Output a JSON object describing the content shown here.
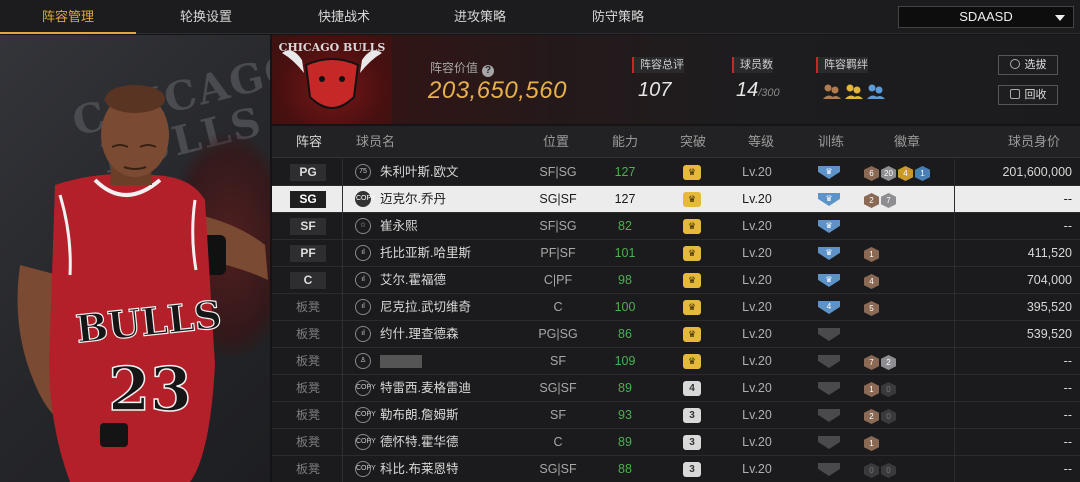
{
  "tabs": [
    "阵容管理",
    "轮换设置",
    "快捷战术",
    "进攻策略",
    "防守策略"
  ],
  "dropdown": {
    "selected": "SDAASD"
  },
  "left_panel": {
    "bg_text_1": "CHICAGO",
    "bg_text_2": "BULLS",
    "jersey_text": "BULLS",
    "jersey_number": "23"
  },
  "header": {
    "logo_text": "CHICAGO BULLS",
    "team_value_label": "阵容价值",
    "team_value": "203,650,560",
    "overall_label": "阵容总评",
    "overall_value": "107",
    "players_label": "球员数",
    "players_value": "14",
    "players_max": "/300",
    "bond_label": "阵容羁绊",
    "buttons": {
      "select": "选拔",
      "recycle": "回收"
    }
  },
  "table": {
    "headers": [
      "阵容",
      "球员名",
      "位置",
      "能力",
      "突破",
      "等级",
      "训练",
      "徽章",
      "球员身价"
    ],
    "rows": [
      {
        "slot": "PG",
        "icon": "75",
        "name": "朱利叶斯.欧文",
        "pos": "SF|SG",
        "ability": "127",
        "break": "crown",
        "level": "Lv.20",
        "train": "on",
        "badges": [
          [
            "b",
            "6"
          ],
          [
            "s",
            "20"
          ],
          [
            "g",
            "4"
          ],
          [
            "bl",
            "1"
          ]
        ],
        "value": "201,600,000"
      },
      {
        "slot": "SG",
        "icon": "COPY",
        "name": "迈克尔.乔丹",
        "pos": "SG|SF",
        "ability": "127",
        "break": "crown",
        "level": "Lv.20",
        "train": "on",
        "badges": [
          [
            "b",
            "2"
          ],
          [
            "s",
            "7"
          ]
        ],
        "value": "--"
      },
      {
        "slot": "SF",
        "icon": "☆",
        "name": "崔永熙",
        "pos": "SF|SG",
        "ability": "82",
        "break": "crown",
        "level": "Lv.20",
        "train": "on",
        "badges": [],
        "value": "--"
      },
      {
        "slot": "PF",
        "icon": "ıl",
        "name": "托比亚斯.哈里斯",
        "pos": "PF|SF",
        "ability": "101",
        "break": "crown",
        "level": "Lv.20",
        "train": "on",
        "badges": [
          [
            "b",
            "1"
          ]
        ],
        "value": "411,520"
      },
      {
        "slot": "C",
        "icon": "ıl",
        "name": "艾尔.霍福德",
        "pos": "C|PF",
        "ability": "98",
        "break": "crown",
        "level": "Lv.20",
        "train": "on",
        "badges": [
          [
            "b",
            "4"
          ]
        ],
        "value": "704,000"
      },
      {
        "slot": "板凳",
        "icon": "ıl",
        "name": "尼克拉.武切维奇",
        "pos": "C",
        "ability": "100",
        "break": "crown",
        "level": "Lv.20",
        "train": "on4",
        "badges": [
          [
            "b",
            "5"
          ]
        ],
        "value": "395,520"
      },
      {
        "slot": "板凳",
        "icon": "ıl",
        "name": "约什.理查德森",
        "pos": "PG|SG",
        "ability": "86",
        "break": "crown",
        "level": "Lv.20",
        "train": "off",
        "badges": [],
        "value": "539,520"
      },
      {
        "slot": "板凳",
        "icon": "♙",
        "name": "",
        "pos": "SF",
        "ability": "109",
        "break": "crown",
        "level": "Lv.20",
        "train": "off",
        "badges": [
          [
            "b",
            "7"
          ],
          [
            "s",
            "2"
          ]
        ],
        "value": "--"
      },
      {
        "slot": "板凳",
        "icon": "COPY",
        "name": "特雷西.麦格雷迪",
        "pos": "SG|SF",
        "ability": "89",
        "break": "4",
        "level": "Lv.20",
        "train": "off",
        "badges": [
          [
            "b",
            "1"
          ],
          [
            "d",
            "0"
          ]
        ],
        "value": "--"
      },
      {
        "slot": "板凳",
        "icon": "COPY",
        "name": "勒布朗.詹姆斯",
        "pos": "SF",
        "ability": "93",
        "break": "3",
        "level": "Lv.20",
        "train": "off",
        "badges": [
          [
            "b",
            "2"
          ],
          [
            "d",
            "0"
          ]
        ],
        "value": "--"
      },
      {
        "slot": "板凳",
        "icon": "COPY",
        "name": "德怀特.霍华德",
        "pos": "C",
        "ability": "89",
        "break": "3",
        "level": "Lv.20",
        "train": "off",
        "badges": [
          [
            "b",
            "1"
          ]
        ],
        "value": "--"
      },
      {
        "slot": "板凳",
        "icon": "COPY",
        "name": "科比.布莱恩特",
        "pos": "SG|SF",
        "ability": "88",
        "break": "3",
        "level": "Lv.20",
        "train": "off",
        "badges": [
          [
            "d",
            "0"
          ],
          [
            "d",
            "0"
          ]
        ],
        "value": "--"
      }
    ]
  },
  "colors": {
    "accent": "#e0a83a",
    "ability_green": "#4caf50",
    "red": "#c62828"
  }
}
